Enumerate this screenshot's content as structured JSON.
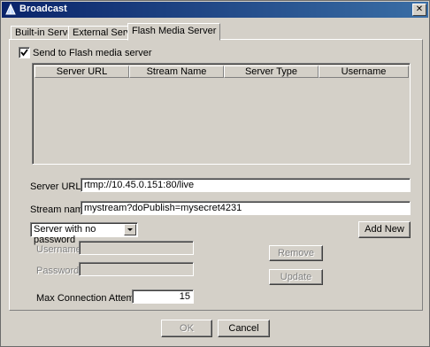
{
  "window": {
    "title": "Broadcast",
    "close_glyph": "✕"
  },
  "tabs": [
    {
      "label": "Built-in Server"
    },
    {
      "label": "External Server"
    },
    {
      "label": "Flash Media Server"
    }
  ],
  "send_checkbox": {
    "label": "Send to Flash media server",
    "checked": true
  },
  "table": {
    "columns": [
      "Server URL",
      "Stream Name",
      "Server Type",
      "Username"
    ],
    "rows": []
  },
  "form": {
    "server_url_label": "Server URL:",
    "server_url_value": "rtmp://10.45.0.151:80/live",
    "stream_name_label": "Stream name:",
    "stream_name_value": "mystream?doPublish=mysecret4231",
    "auth_select_value": "Server with no password",
    "username_label": "Username:",
    "username_value": "",
    "password_label": "Password:",
    "password_value": "",
    "max_attempts_label": "Max Connection Attempts:",
    "max_attempts_value": "15"
  },
  "buttons": {
    "add_new": "Add New",
    "remove": "Remove",
    "update": "Update",
    "ok": "OK",
    "cancel": "Cancel"
  },
  "icons": {
    "app": "broadcast-icon",
    "close": "close-icon",
    "check": "checkmark-icon",
    "dropdown": "chevron-down-icon"
  }
}
